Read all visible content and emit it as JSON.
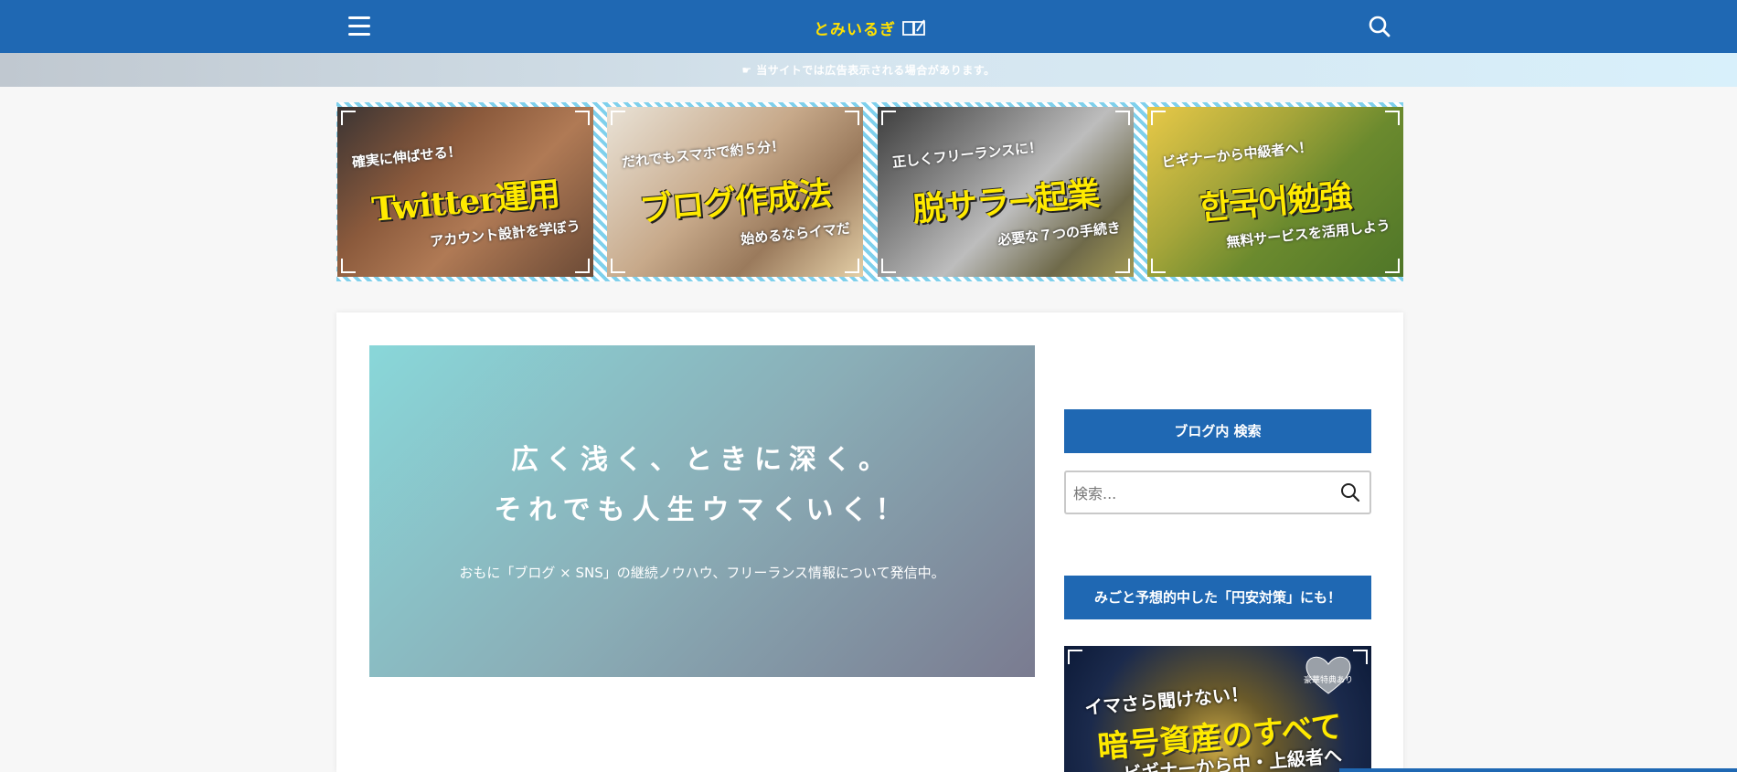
{
  "header": {
    "site_name": "とみいるぎ",
    "colors": {
      "bar": "#1f68b3",
      "logo": "#ffe100"
    }
  },
  "notice": {
    "text": "☛ 当サイトでは広告表示される場合があります。"
  },
  "featured": [
    {
      "top_text": "確実に伸ばせる！",
      "title": "Twitter運用",
      "bottom_text": "アカウント設計を学ぼう"
    },
    {
      "top_text": "だれでもスマホで約５分！",
      "title": "ブログ作成法",
      "bottom_text": "始めるならイマだ"
    },
    {
      "top_text": "正しくフリーランスに！",
      "title": "脱サラ→起業",
      "bottom_text": "必要な７つの手続き"
    },
    {
      "top_text": "ビギナーから中級者へ！",
      "title": "한국어勉強",
      "bottom_text": "無料サービスを活用しよう"
    }
  ],
  "hero": {
    "line1": "広く浅く、ときに深く。",
    "line2": "それでも人生ウマくいく！",
    "description": "おもに「ブログ × SNS」の継続ノウハウ、フリーランス情報について発信中。"
  },
  "sidebar": {
    "search_widget_title": "ブログ内 検索",
    "search_placeholder": "検索...",
    "promo_widget_title": "みごと予想的中した「円安対策」にも！",
    "promo": {
      "badge": "豪華特典あり",
      "sub_text": "イマさら聞けない！",
      "title": "暗号資産のすべて",
      "sub_text2": "ビギナーから中・上級者へ"
    }
  }
}
